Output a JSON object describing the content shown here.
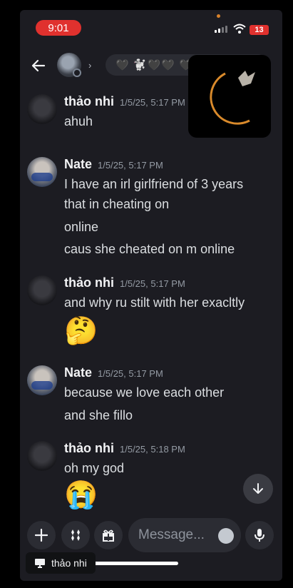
{
  "status_bar": {
    "time": "9:01",
    "battery": "13"
  },
  "header": {
    "channel_name": "🖤 🐩🖤🖤 🖤"
  },
  "messages": [
    {
      "author": "thảo nhi",
      "timestamp": "1/5/25, 5:17 PM",
      "lines": [
        "ahuh"
      ],
      "emoji": ""
    },
    {
      "author": "Nate",
      "timestamp": "1/5/25, 5:17 PM",
      "lines": [
        "I have an irl girlfriend of 3 years",
        "that in cheating on",
        "online",
        "caus she cheated on m online"
      ],
      "emoji": ""
    },
    {
      "author": "thảo nhi",
      "timestamp": "1/5/25, 5:17 PM",
      "lines": [
        "and why ru stilt with her exacltly"
      ],
      "emoji": "🤔"
    },
    {
      "author": "Nate",
      "timestamp": "1/5/25, 5:17 PM",
      "lines": [
        "because we love each other",
        "and she fillo"
      ],
      "emoji": ""
    },
    {
      "author": "thảo nhi",
      "timestamp": "1/5/25, 5:18 PM",
      "lines": [
        "oh my god"
      ],
      "emoji": "😭"
    }
  ],
  "composer": {
    "placeholder": "Message..."
  },
  "tooltip": {
    "label": "thảo nhi"
  },
  "icons": [
    "back-arrow-icon",
    "plus-icon",
    "apps-icon",
    "gift-icon",
    "emoji-icon",
    "microphone-icon",
    "arrow-down-icon"
  ]
}
